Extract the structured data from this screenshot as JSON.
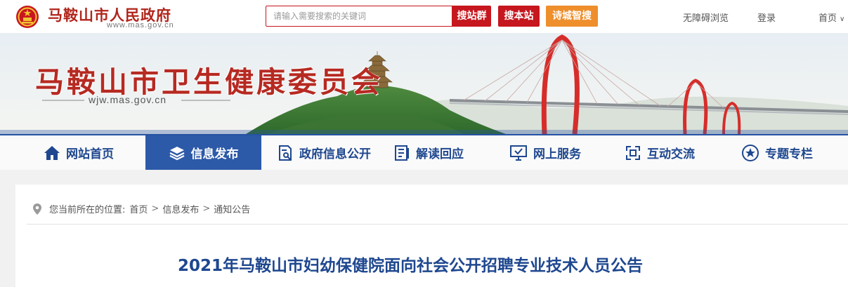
{
  "header": {
    "site_title": "马鞍山市人民政府",
    "site_url": "www.mas.gov.cn",
    "search_placeholder": "请输入需要搜索的关键词",
    "btn_site_group": "搜站群",
    "btn_this_site": "搜本站",
    "btn_poetry": "诗城智搜",
    "accessibility": "无障碍浏览",
    "login": "登录",
    "home": "首页"
  },
  "banner": {
    "title": "马鞍山市卫生健康委员会",
    "url": "wjw.mas.gov.cn"
  },
  "nav": {
    "items": [
      {
        "label": "网站首页",
        "icon": "home-icon"
      },
      {
        "label": "信息发布",
        "icon": "layers-icon"
      },
      {
        "label": "政府信息公开",
        "icon": "document-search-icon"
      },
      {
        "label": "解读回应",
        "icon": "doc-list-icon"
      },
      {
        "label": "网上服务",
        "icon": "monitor-check-icon"
      },
      {
        "label": "互动交流",
        "icon": "exchange-icon"
      },
      {
        "label": "专题专栏",
        "icon": "star-circle-icon"
      }
    ],
    "active_index": 1
  },
  "breadcrumb": {
    "prefix": "您当前所在的位置:",
    "items": [
      "首页",
      "信息发布",
      "通知公告"
    ],
    "separator": ">"
  },
  "article": {
    "title": "2021年马鞍山市妇幼保健院面向社会公开招聘专业技术人员公告"
  },
  "colors": {
    "brand_red": "#c6161e",
    "nav_blue": "#2d5aa8",
    "title_blue": "#1e478f",
    "orange": "#ee8f2c"
  }
}
